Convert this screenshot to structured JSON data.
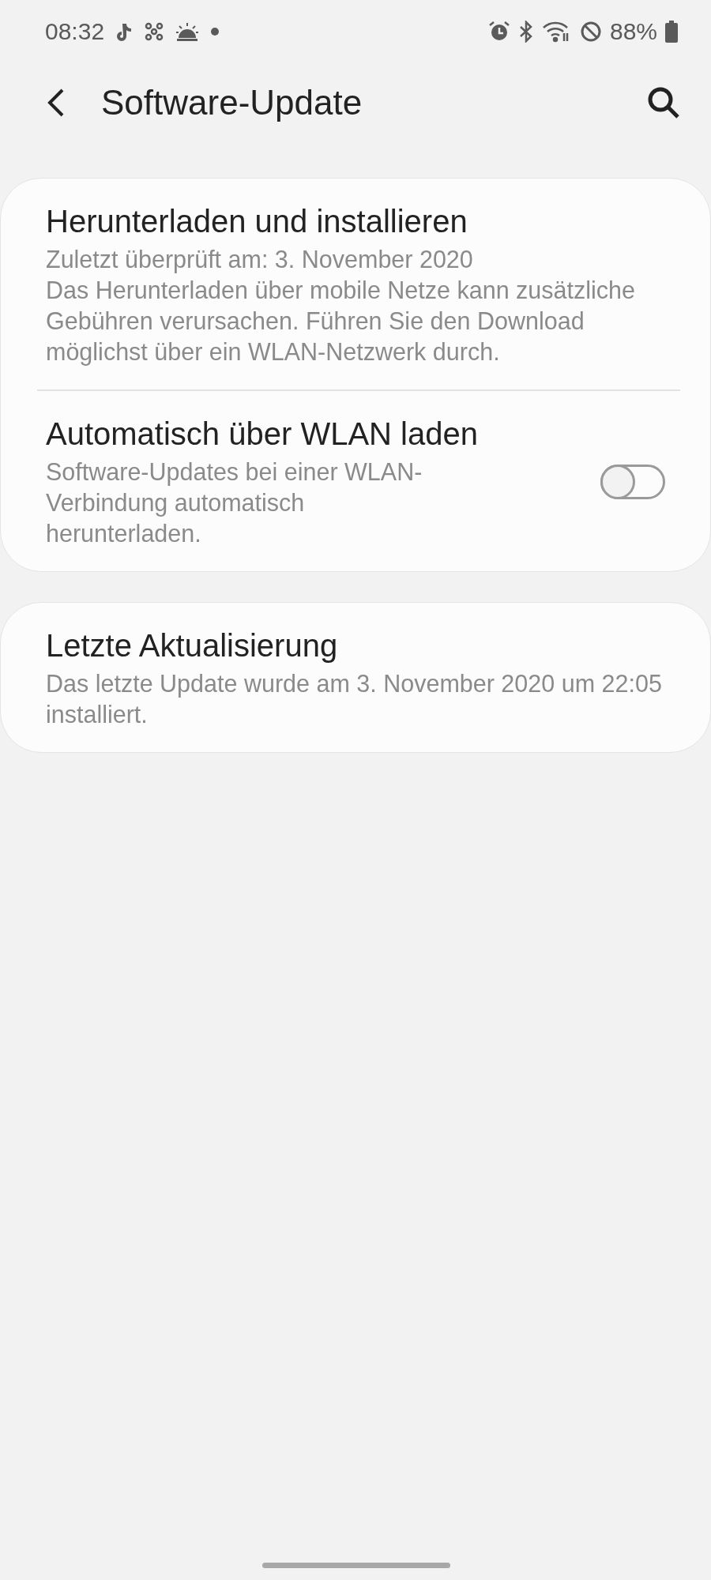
{
  "status_bar": {
    "time": "08:32",
    "battery": "88%"
  },
  "app_bar": {
    "title": "Software-Update"
  },
  "cards": [
    {
      "items": [
        {
          "kind": "text",
          "title": "Herunterladen und installieren",
          "lines": [
            "Zuletzt überprüft am: 3. November 2020",
            "Das Herunterladen über mobile Netze kann zusätzliche Gebühren verursachen. Führen Sie den Download möglichst über ein WLAN-Netzwerk durch."
          ]
        },
        {
          "kind": "switch",
          "title": "Automatisch über WLAN laden",
          "lines": [
            "Software-Updates bei einer WLAN-Verbindung automatisch herunterladen."
          ],
          "on": false
        }
      ]
    },
    {
      "items": [
        {
          "kind": "text",
          "title": "Letzte Aktualisierung",
          "lines": [
            "Das letzte Update wurde am 3. November 2020 um 22:05 installiert."
          ]
        }
      ]
    }
  ]
}
